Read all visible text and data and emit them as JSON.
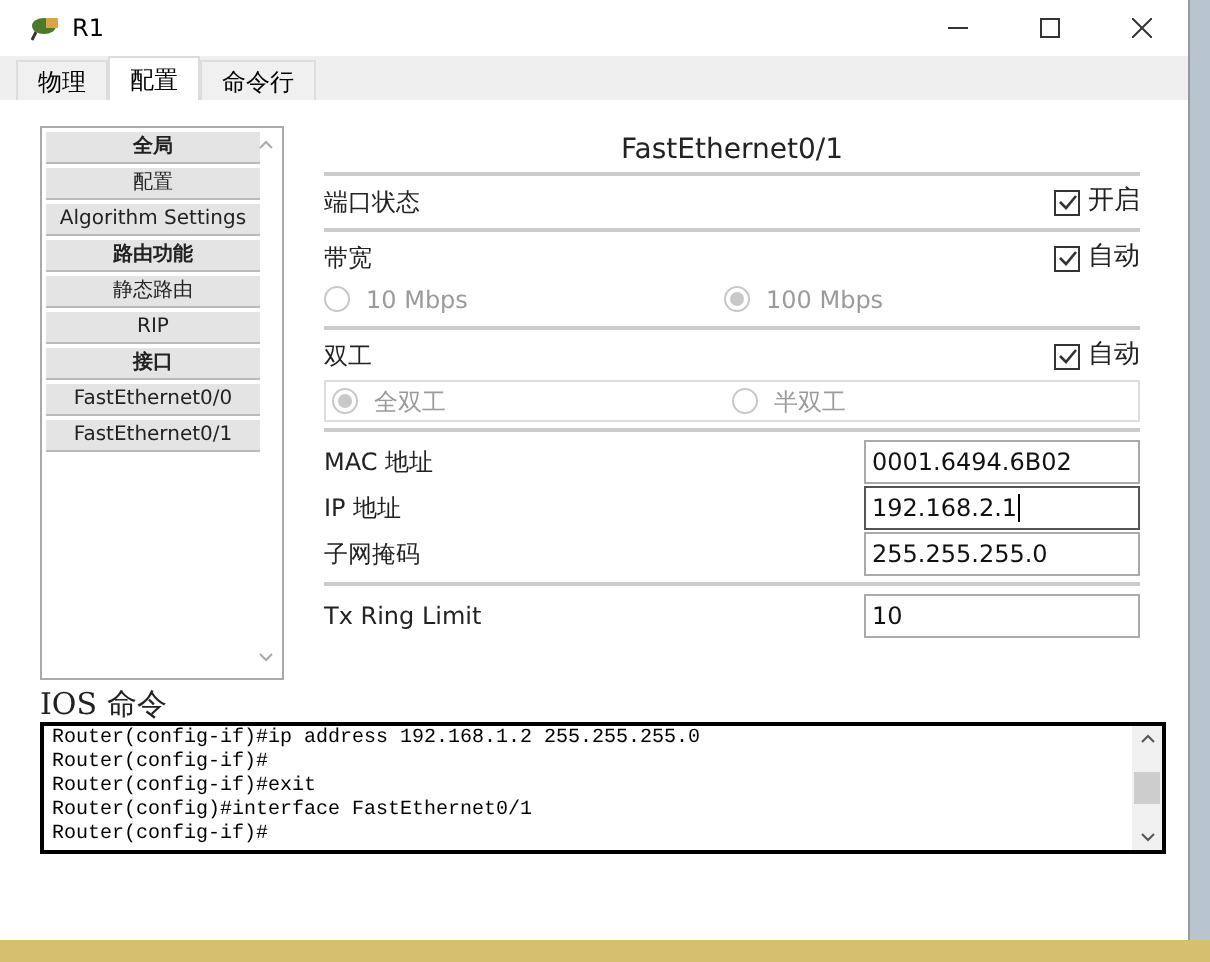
{
  "window": {
    "title": "R1"
  },
  "tabs": [
    {
      "label": "物理",
      "selected": false
    },
    {
      "label": "配置",
      "selected": true
    },
    {
      "label": "命令行",
      "selected": false
    }
  ],
  "sidebar": {
    "items": [
      {
        "label": "全局",
        "kind": "header"
      },
      {
        "label": "配置",
        "kind": "item"
      },
      {
        "label": "Algorithm Settings",
        "kind": "item"
      },
      {
        "label": "路由功能",
        "kind": "header"
      },
      {
        "label": "静态路由",
        "kind": "item"
      },
      {
        "label": "RIP",
        "kind": "item"
      },
      {
        "label": "接口",
        "kind": "header"
      },
      {
        "label": "FastEthernet0/0",
        "kind": "item"
      },
      {
        "label": "FastEthernet0/1",
        "kind": "item"
      }
    ]
  },
  "panel": {
    "title": "FastEthernet0/1",
    "sections": [
      {
        "label": "端口状态",
        "check_label": "开启",
        "checked": true
      },
      {
        "label": "带宽",
        "check_label": "自动",
        "checked": true,
        "boxed": false,
        "options": [
          {
            "label": "10 Mbps",
            "selected": false
          },
          {
            "label": "100 Mbps",
            "selected": true
          }
        ]
      },
      {
        "label": "双工",
        "check_label": "自动",
        "checked": true,
        "boxed": true,
        "options": [
          {
            "label": "全双工",
            "selected": true
          },
          {
            "label": "半双工",
            "selected": false
          }
        ]
      }
    ],
    "fields": [
      {
        "label": "MAC 地址",
        "value": "0001.6494.6B02",
        "focused": false
      },
      {
        "label": "IP 地址",
        "value": "192.168.2.1",
        "focused": true
      },
      {
        "label": "子网掩码",
        "value": "255.255.255.0",
        "focused": false
      }
    ],
    "tx_field": {
      "label": "Tx Ring Limit",
      "value": "10",
      "focused": false
    }
  },
  "ios": {
    "label": "IOS 命令",
    "lines": [
      "Router(config-if)#ip address 192.168.1.2 255.255.255.0",
      "Router(config-if)#",
      "Router(config-if)#exit",
      "Router(config)#interface FastEthernet0/1",
      "Router(config-if)#"
    ]
  }
}
